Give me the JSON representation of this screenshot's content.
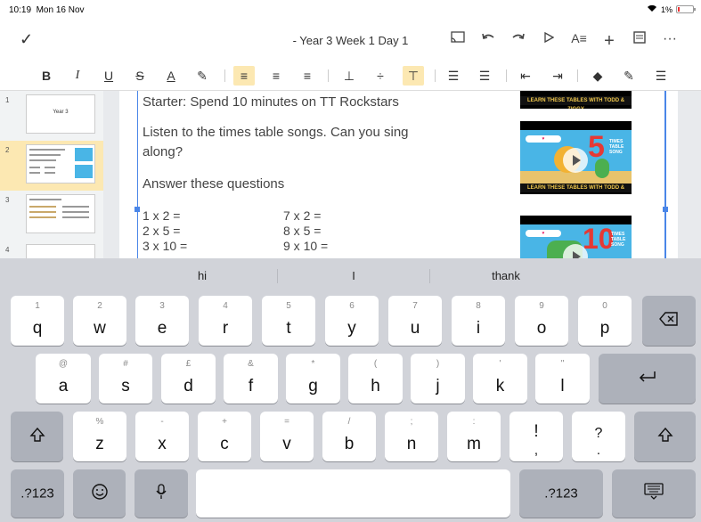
{
  "status": {
    "time": "10:19",
    "date": "Mon 16 Nov",
    "battery": "1%"
  },
  "header": {
    "title": "- Year 3 Week 1 Day 1",
    "icons": [
      "cast-icon",
      "undo-icon",
      "redo-icon",
      "present-icon",
      "text-format-icon",
      "insert-icon",
      "comment-icon",
      "more-icon"
    ]
  },
  "format": {
    "tools": [
      "B",
      "I",
      "U",
      "S",
      "A"
    ]
  },
  "slides": [
    {
      "num": "1",
      "title": "Year 3"
    },
    {
      "num": "2"
    },
    {
      "num": "3"
    },
    {
      "num": "4"
    }
  ],
  "slide": {
    "starter": "Starter: Spend 10 minutes on TT Rockstars",
    "listen_line1": "Listen to the times table songs. Can you sing",
    "listen_line2": "along?",
    "answer": "Answer these questions",
    "q_left": [
      "1 x 2 =",
      "2 x 5 =",
      "3 x 10 ="
    ],
    "q_right": [
      "7 x 2 =",
      "8 x 5 =",
      "9 x 10 ="
    ],
    "video_banner": "LEARN THESE TABLES WITH TODD & ZIGGY",
    "video1_number": "5",
    "video2_number": "10",
    "video_small": "TIMES TABLE SONG"
  },
  "keyboard": {
    "suggestions": [
      "hi",
      "I",
      "thank"
    ],
    "row1": [
      {
        "main": "q",
        "hint": "1"
      },
      {
        "main": "w",
        "hint": "2"
      },
      {
        "main": "e",
        "hint": "3"
      },
      {
        "main": "r",
        "hint": "4"
      },
      {
        "main": "t",
        "hint": "5"
      },
      {
        "main": "y",
        "hint": "6"
      },
      {
        "main": "u",
        "hint": "7"
      },
      {
        "main": "i",
        "hint": "8"
      },
      {
        "main": "o",
        "hint": "9"
      },
      {
        "main": "p",
        "hint": "0"
      }
    ],
    "row2": [
      {
        "main": "a",
        "hint": "@"
      },
      {
        "main": "s",
        "hint": "#"
      },
      {
        "main": "d",
        "hint": "£"
      },
      {
        "main": "f",
        "hint": "&"
      },
      {
        "main": "g",
        "hint": "*"
      },
      {
        "main": "h",
        "hint": "("
      },
      {
        "main": "j",
        "hint": ")"
      },
      {
        "main": "k",
        "hint": "'"
      },
      {
        "main": "l",
        "hint": "\""
      }
    ],
    "row3": [
      {
        "main": "z",
        "hint": "%"
      },
      {
        "main": "x",
        "hint": "-"
      },
      {
        "main": "c",
        "hint": "+"
      },
      {
        "main": "v",
        "hint": "="
      },
      {
        "main": "b",
        "hint": "/"
      },
      {
        "main": "n",
        "hint": ";"
      },
      {
        "main": "m",
        "hint": ":"
      },
      {
        "main": "!",
        "hint": ","
      },
      {
        "main": "?",
        "hint": "."
      }
    ],
    "numbers_label": ".?123"
  }
}
